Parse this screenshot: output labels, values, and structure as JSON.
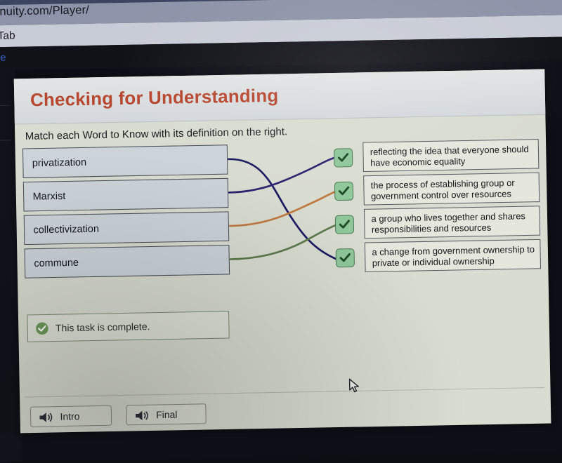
{
  "browser": {
    "url": "genuity.com/Player/",
    "bookmark": "w Tab",
    "page_link": "line"
  },
  "rail": {
    "pencil_icon": "pencil-icon",
    "undo_icon": "undo-arrow-icon"
  },
  "panel": {
    "title": "Checking for Understanding",
    "title_color": "#b8472f",
    "instruction": "Match each Word to Know with its definition on the right."
  },
  "matching": {
    "words": [
      {
        "label": "privatization"
      },
      {
        "label": "Marxist"
      },
      {
        "label": "collectivization"
      },
      {
        "label": "commune"
      }
    ],
    "definitions": [
      {
        "text": "reflecting the idea that everyone should have economic equality"
      },
      {
        "text": "the process of establishing group or government control over resources"
      },
      {
        "text": "a group who lives together and shares responsibilities and resources"
      },
      {
        "text": "a change from government ownership to private or individual ownership"
      }
    ],
    "connections": [
      {
        "from_word": 0,
        "to_definition": 3,
        "color": "#1b1b63"
      },
      {
        "from_word": 1,
        "to_definition": 0,
        "color": "#2a2470"
      },
      {
        "from_word": 2,
        "to_definition": 1,
        "color": "#c07a40"
      },
      {
        "from_word": 3,
        "to_definition": 2,
        "color": "#5d7b4d"
      }
    ],
    "check_icon": "check-icon",
    "check_fill": "#8fc79a"
  },
  "status": {
    "text": "This task is complete.",
    "icon": "check-circle-icon",
    "color": "#5f8a4f"
  },
  "footer": {
    "buttons": [
      {
        "label": "Intro",
        "icon": "speaker-icon"
      },
      {
        "label": "Final",
        "icon": "speaker-icon"
      }
    ]
  },
  "cursor": {
    "icon": "mouse-pointer-icon"
  }
}
